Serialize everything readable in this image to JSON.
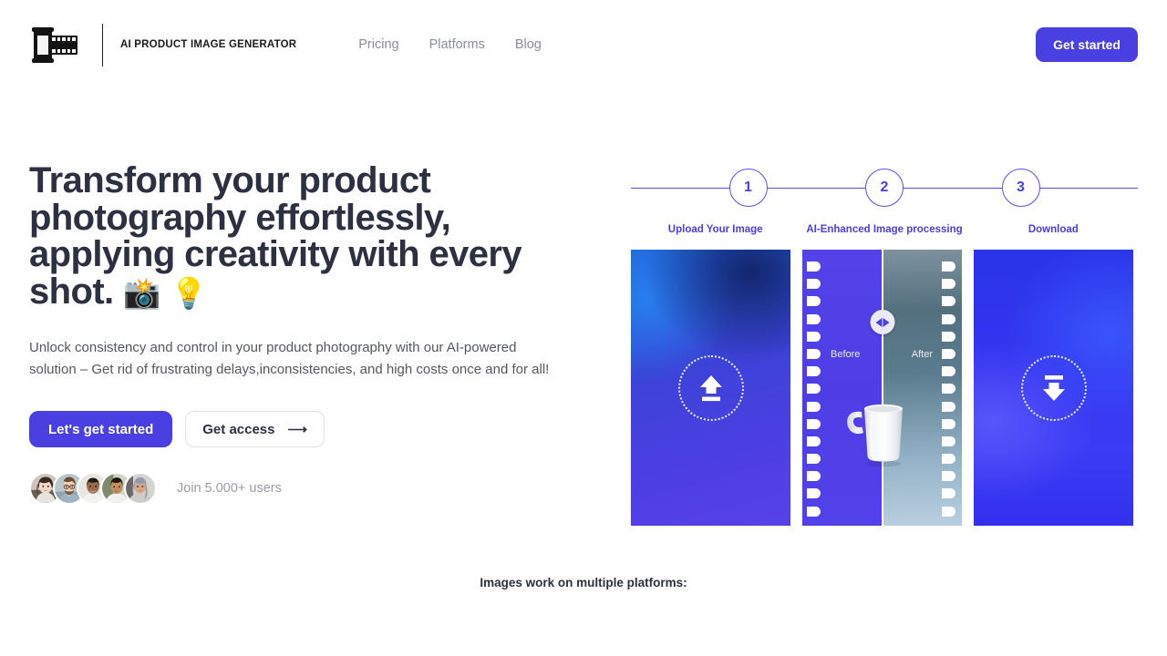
{
  "header": {
    "logo_icon": "film-roll-icon",
    "brand_name": "AI PRODUCT IMAGE GENERATOR",
    "nav": [
      {
        "label": "Pricing"
      },
      {
        "label": "Platforms"
      },
      {
        "label": "Blog"
      }
    ],
    "cta_label": "Get started"
  },
  "hero": {
    "title_line1": "Transform your product",
    "title_line2": "photography effortlessly,",
    "title_line3": "applying creativity with every",
    "title_line4": "shot.",
    "title_emoji_1": "📸",
    "title_emoji_2": "💡",
    "subtitle": "Unlock consistency and control in your product photography with our AI-powered solution – Get rid of frustrating delays,inconsistencies, and high costs once and for all!",
    "primary_cta": "Let's get started",
    "secondary_cta": "Get access",
    "secondary_cta_icon": "arrow-right-icon",
    "social_proof": "Join 5.000+ users",
    "avatar_count": 5
  },
  "stepper": {
    "steps": [
      {
        "number": "1",
        "label": "Upload Your Image"
      },
      {
        "number": "2",
        "label": "AI-Enhanced Image processing"
      },
      {
        "number": "3",
        "label": "Download"
      }
    ]
  },
  "panels": {
    "upload": {
      "icon": "upload-icon"
    },
    "compare": {
      "before_label": "Before",
      "after_label": "After",
      "handle_icon": "compare-slider-icon",
      "subject": "white-mug"
    },
    "download": {
      "icon": "download-icon"
    }
  },
  "footer": {
    "platforms_note": "Images work on multiple platforms:"
  },
  "colors": {
    "accent": "#4a3fe0",
    "accent_light": "#5b4fe8",
    "text_dark": "#2c3041",
    "text_muted": "#8b8d98",
    "text_subtle": "#9a9ca5"
  }
}
